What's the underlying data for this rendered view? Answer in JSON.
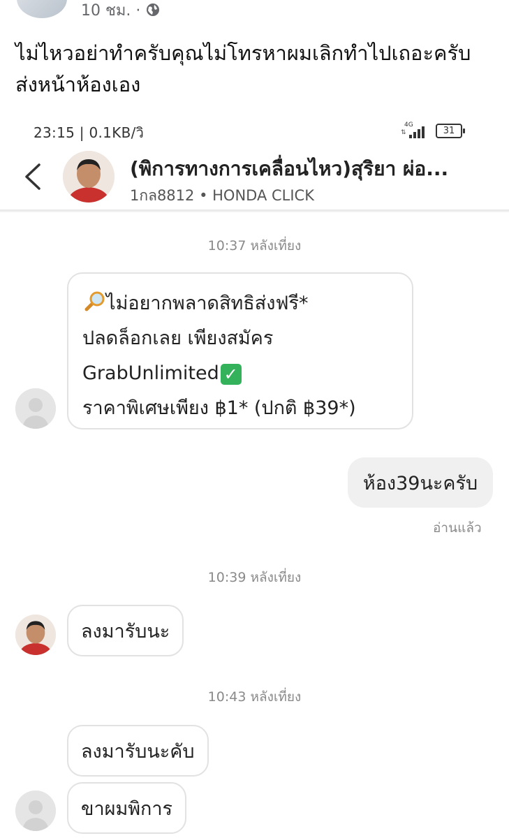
{
  "post": {
    "time": "10 ชม. ·",
    "text_line1": "ไม่ไหวอย่าทำครับคุณไม่โทรหาผมเลิกทำไปเถอะครับ",
    "text_line2": "ส่งหน้าห้องเอง"
  },
  "status_bar": {
    "time": "23:15 | 0.1KB/วิ",
    "network": "4G",
    "battery": "31"
  },
  "chat_header": {
    "title": "(พิการทางการเคลื่อนไหว)สุริยา ผ่อ...",
    "subtitle": "1กล8812 • HONDA CLICK"
  },
  "messages": {
    "t1": "10:37 หลังเที่ยง",
    "promo_line1": "ไม่อยากพลาดสิทธิส่งฟรี*",
    "promo_line2": "ปลดล็อกเลย เพียงสมัคร",
    "promo_line3": "GrabUnlimited",
    "promo_check": "✓",
    "promo_line4": "ราคาพิเศษเพียง ฿1* (ปกติ ฿39*)",
    "outgoing": "ห้อง39นะครับ",
    "read": "อ่านแล้ว",
    "t2": "10:39 หลังเที่ยง",
    "m2": "ลงมารับนะ",
    "t3": "10:43 หลังเที่ยง",
    "m3": "ลงมารับนะคับ",
    "m4": "ขาผมพิการ"
  },
  "icons": {
    "globe": "globe-icon",
    "back": "back-arrow-icon",
    "search": "magnifier-icon",
    "check": "check-mark-icon"
  },
  "colors": {
    "read_gray": "#8a8a8a",
    "check_green": "#33b15b",
    "bubble_border": "#e2e2e2",
    "outgoing_bg": "#f0f0f0"
  }
}
